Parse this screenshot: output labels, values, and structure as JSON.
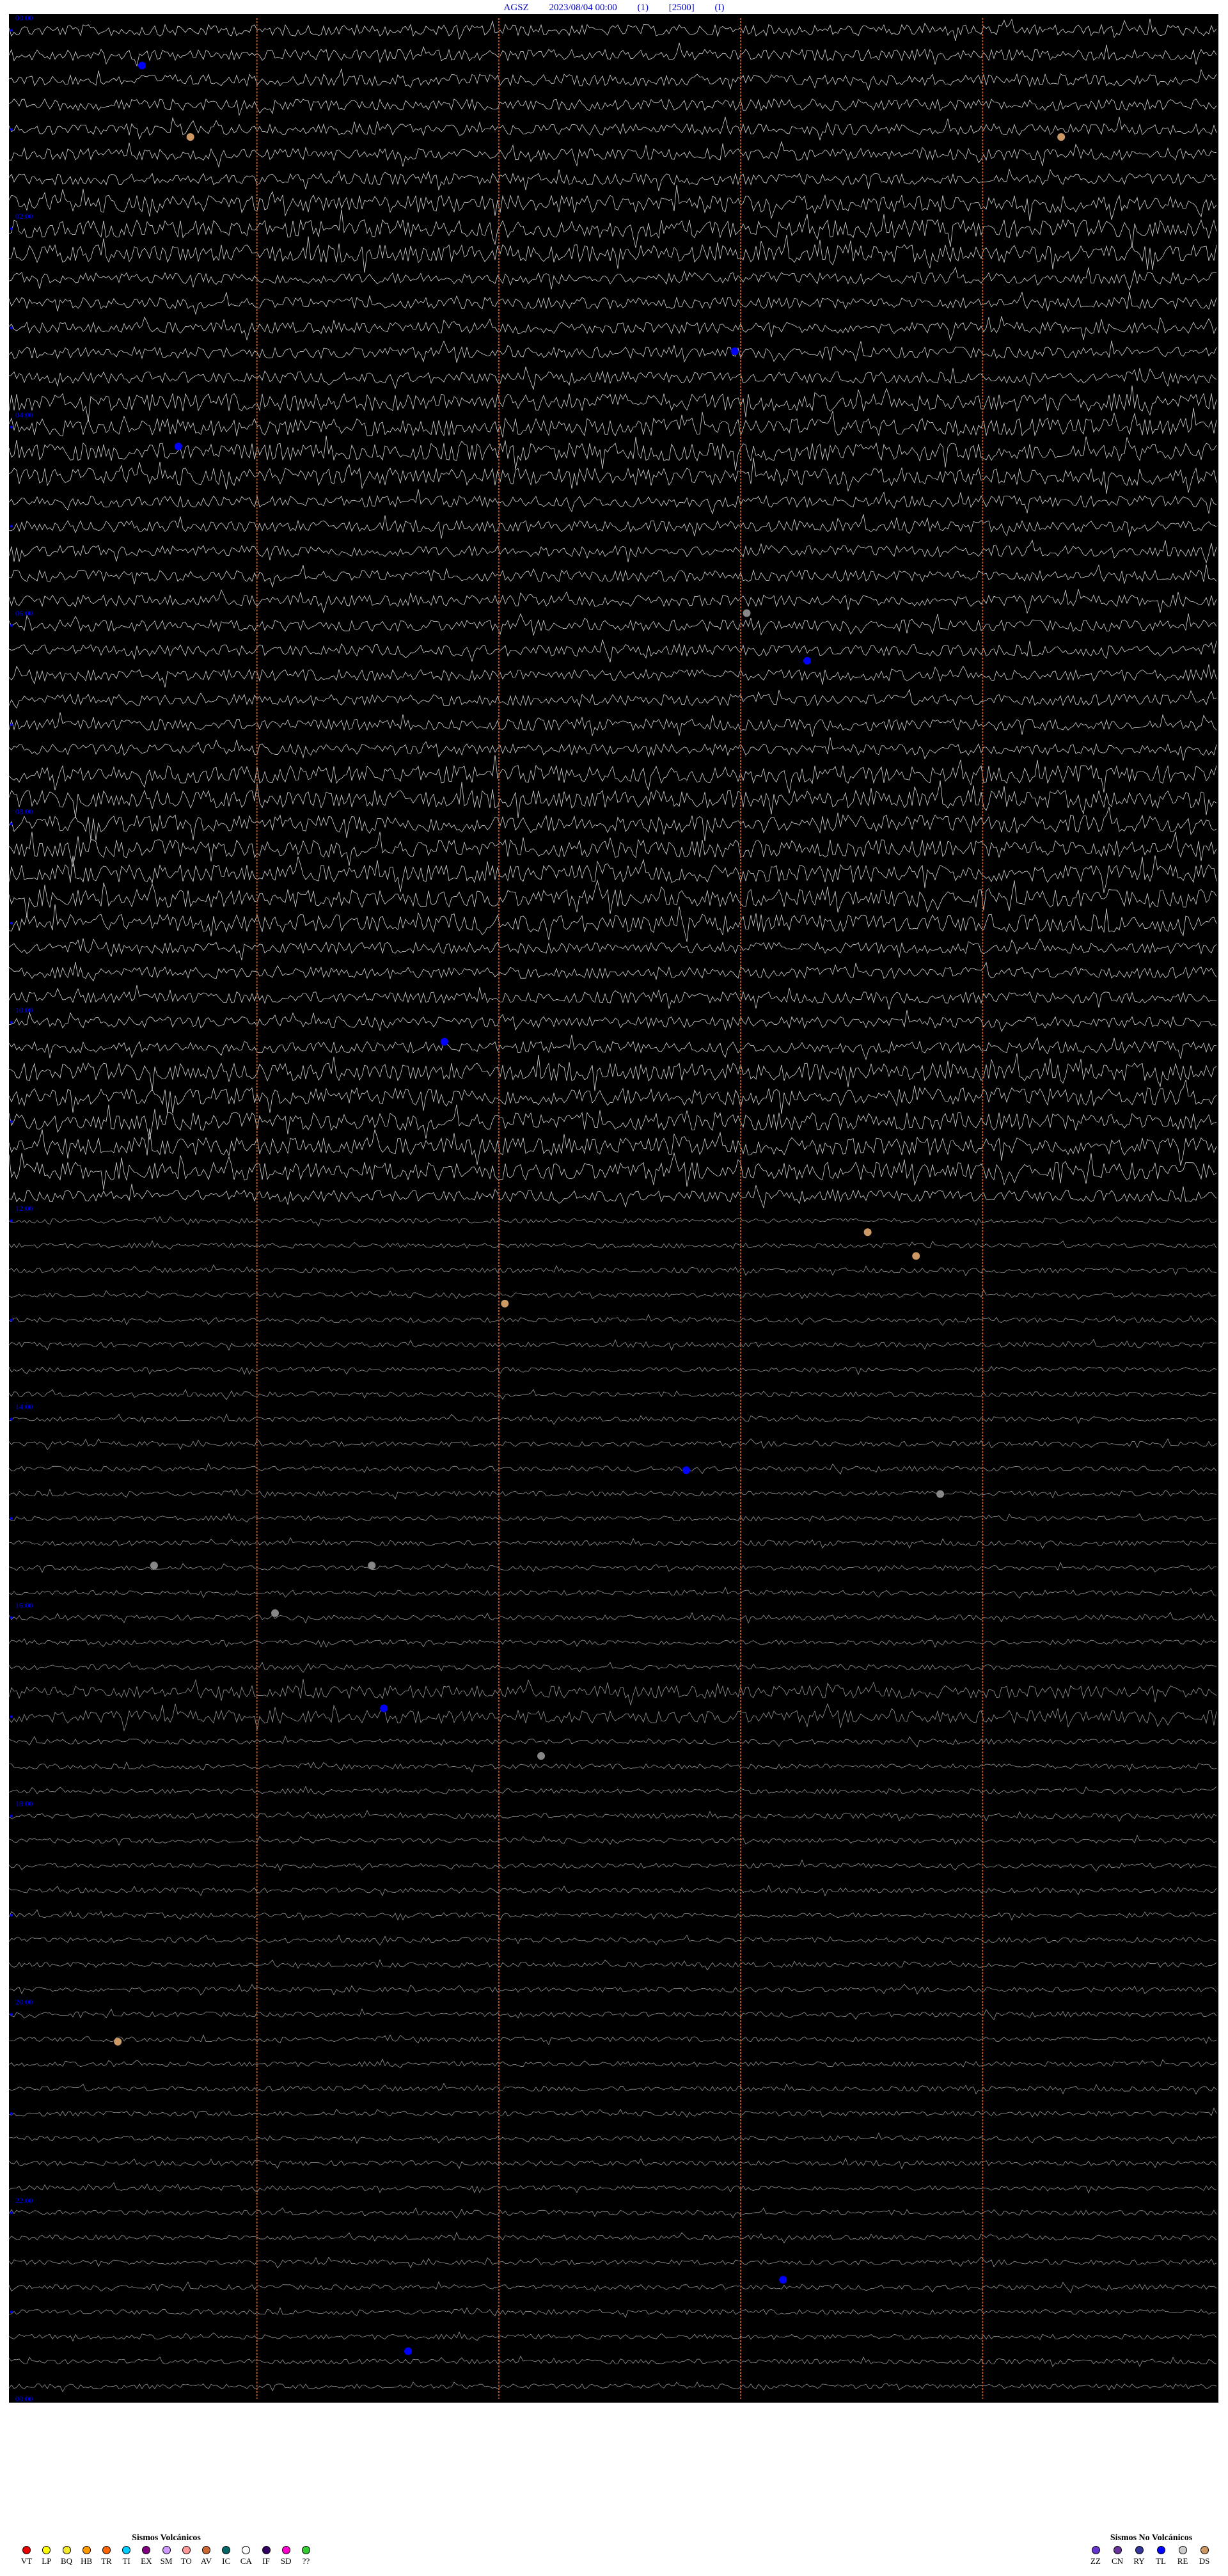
{
  "header": {
    "station": "AGSZ",
    "datetime": "2023/08/04 00:00",
    "channel": "(1)",
    "scale": "[2500]",
    "flag": "(I)"
  },
  "chart_data": {
    "type": "helicorder",
    "time_labels": [
      "00:00",
      "02:00",
      "04:00",
      "06:00",
      "08:00",
      "10:00",
      "12:00",
      "14:00",
      "16:00",
      "18:00",
      "20:00",
      "22:00",
      "00:00"
    ],
    "background": "#000000",
    "trace_color": "#ffffff",
    "minute_line_color": "#b4501e",
    "label_color": "#0000ff",
    "grid": false
  },
  "legend_volcanic": {
    "title": "Sismos Volcánicos",
    "items": [
      {
        "code": "VT",
        "color": "#e60000"
      },
      {
        "code": "LP",
        "color": "#ffff00"
      },
      {
        "code": "BQ",
        "color": "#f2ea2a"
      },
      {
        "code": "HB",
        "color": "#ff9900"
      },
      {
        "code": "TR",
        "color": "#ff6600"
      },
      {
        "code": "TI",
        "color": "#00ccff"
      },
      {
        "code": "EX",
        "color": "#800080"
      },
      {
        "code": "SM",
        "color": "#cc99ff"
      },
      {
        "code": "TO",
        "color": "#ff9999"
      },
      {
        "code": "AV",
        "color": "#cc6633"
      },
      {
        "code": "IC",
        "color": "#006666"
      },
      {
        "code": "CA",
        "color": "#ffffff"
      },
      {
        "code": "IF",
        "color": "#330066"
      },
      {
        "code": "SD",
        "color": "#ff00cc"
      },
      {
        "code": "??",
        "color": "#33cc33"
      }
    ]
  },
  "legend_non_volcanic": {
    "title": "Sismos No Volcánicos",
    "items": [
      {
        "code": "ZZ",
        "color": "#6633cc"
      },
      {
        "code": "CN",
        "color": "#663399"
      },
      {
        "code": "RY",
        "color": "#333399"
      },
      {
        "code": "TL",
        "color": "#0000ff"
      },
      {
        "code": "RE",
        "color": "#cccccc"
      },
      {
        "code": "DS",
        "color": "#cc9966"
      }
    ]
  }
}
